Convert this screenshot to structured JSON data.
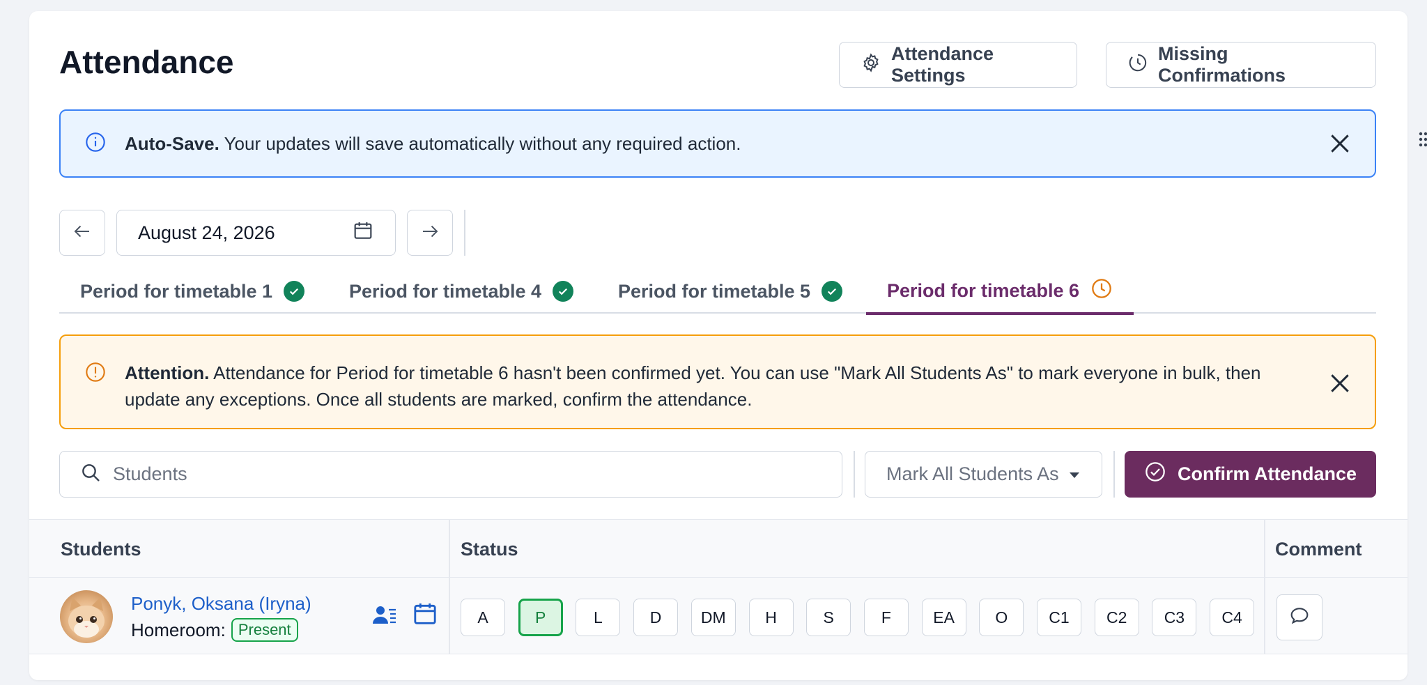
{
  "page": {
    "title": "Attendance",
    "settings_button": "Attendance Settings",
    "missing_button": "Missing Confirmations"
  },
  "info_banner": {
    "strong": "Auto-Save.",
    "text": " Your updates will save automatically without any required action."
  },
  "date_nav": {
    "date": "August 24, 2026"
  },
  "tabs": [
    {
      "label": "Period for timetable 1",
      "status": "confirmed"
    },
    {
      "label": "Period for timetable 4",
      "status": "confirmed"
    },
    {
      "label": "Period for timetable 5",
      "status": "confirmed"
    },
    {
      "label": "Period for timetable 6",
      "status": "pending",
      "active": true
    }
  ],
  "warn_banner": {
    "strong": "Attention.",
    "text": " Attendance for Period for timetable 6 hasn't been confirmed yet. You can use \"Mark All Students As\" to mark everyone in bulk, then update any exceptions. Once all students are marked, confirm the attendance."
  },
  "toolbar": {
    "search_placeholder": "Students",
    "mark_all_label": "Mark All Students As",
    "confirm_label": "Confirm Attendance"
  },
  "table": {
    "headers": {
      "students": "Students",
      "status": "Status",
      "comment": "Comment"
    },
    "rows": [
      {
        "name": "Ponyk, Oksana (Iryna)",
        "homeroom_label": "Homeroom:",
        "homeroom_status": "Present",
        "statuses": [
          "A",
          "P",
          "L",
          "D",
          "DM",
          "H",
          "S",
          "F",
          "EA",
          "O",
          "C1",
          "C2",
          "C3",
          "C4"
        ],
        "selected_status": "P"
      }
    ]
  },
  "colors": {
    "primary": "#6b2c5f",
    "success": "#11835a",
    "info_border": "#3b82f6",
    "warn_border": "#f59e0b",
    "link": "#1d5fc9"
  }
}
